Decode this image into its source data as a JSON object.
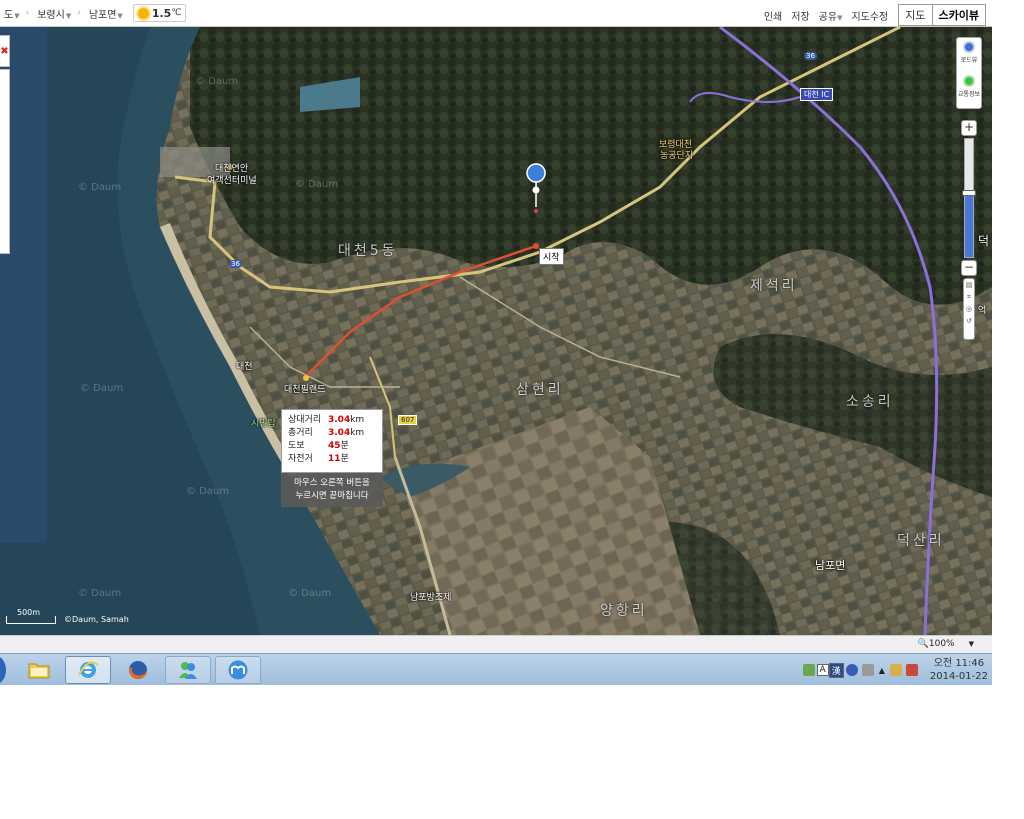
{
  "topbar": {
    "crumbs": [
      "도",
      "보령시",
      "남포면"
    ],
    "weather": "1.5",
    "weather_unit": "℃",
    "links": [
      "인쇄",
      "저장",
      "공유",
      "지도수정"
    ],
    "tab_map": "지도",
    "tab_sky": "스카이뷰"
  },
  "map": {
    "labels": {
      "terminal": "대천연안\n여객선터미널",
      "terminal_1": "대천연안",
      "terminal_2": "여객선터미널",
      "daecheon5dong": "대천5동",
      "start": "시작",
      "industrial_1": "보령대천",
      "industrial_2": "농공단지",
      "daecheon_ic_a": "대천",
      "daecheon_ic_b": "IC",
      "jeseokri": "제석리",
      "samhyeonri": "삼현리",
      "sosongri": "소송리",
      "daecheon": "대천",
      "mudland": "대천필랜드",
      "simin": "시민탑",
      "nampo_dam": "남포방조제",
      "yanghangri": "양항리",
      "nampomyeon": "남포면",
      "deoksanri": "덕산리",
      "route36_a": "36",
      "route36_b": "36",
      "route607": "607",
      "edge_r1": "덕",
      "edge_r2": "억"
    },
    "watermark": "© Daum",
    "scale_label": "500m",
    "copyright": "©Daum, Samah",
    "info": {
      "rows": [
        {
          "k": "상대거리",
          "v": "3.04",
          "u": "km"
        },
        {
          "k": "총거리",
          "v": "3.04",
          "u": "km"
        },
        {
          "k": "도보",
          "v": "45",
          "u": "분"
        },
        {
          "k": "자전거",
          "v": "11",
          "u": "분"
        }
      ],
      "hint_1": "마우스 오른쪽 버튼을",
      "hint_2": "누르시면 끝마칩니다"
    },
    "controls": {
      "roadview": "로드뷰",
      "traffic": "교통정보",
      "zoom_plus": "+",
      "zoom_minus": "−",
      "zoom_level": 0.55
    }
  },
  "statusbar": {
    "zoom": "100%"
  },
  "taskbar": {
    "apps": [
      "folder-icon",
      "ie-icon",
      "firefox-icon",
      "messenger-icon",
      "maxthon-icon"
    ],
    "tray_lang_a": "A",
    "tray_lang_b": "漢",
    "time": "오전 11:46",
    "date": "2014-01-22"
  },
  "colors": {
    "route": "#e05030",
    "expressway": "#8c6fd8",
    "road": "#d6c37c",
    "sea": "#2a4d5e",
    "accent_red": "#d40000"
  }
}
